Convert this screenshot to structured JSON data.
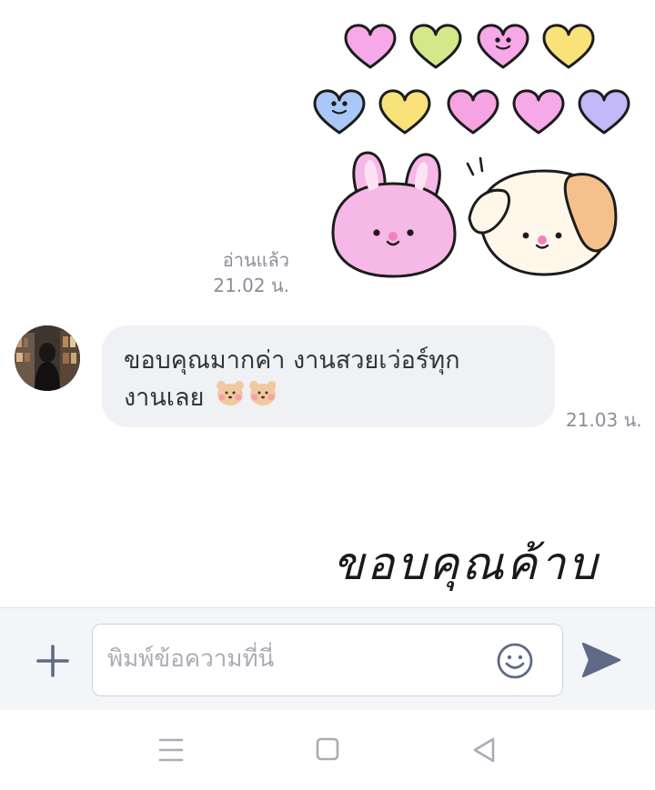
{
  "messages": {
    "sent_sticker": {
      "name": "pastel-hearts-bunny-puppy-sticker",
      "heart_colors": [
        "#f7a8e8",
        "#d4e88a",
        "#f7a8e8",
        "#f9e27a",
        "#a9c8f5",
        "#f9e27a",
        "#f5a3e3",
        "#f7a8e8",
        "#c2b8f7"
      ]
    },
    "read_status": "อ่านแล้ว",
    "sent_time": "21.02 น.",
    "received": {
      "text_line1": "ขอบคุณมากค่า งานสวยเว่อร์ทุก",
      "text_line2": "งานเลย",
      "emoji": "bear-face-emoji",
      "time": "21.03 น."
    },
    "text_sticker": {
      "text": "ขอบคุณค้าบ"
    }
  },
  "input": {
    "placeholder": "พิมพ์ข้อความที่นี่",
    "value": ""
  },
  "icons": {
    "add": "plus-icon",
    "emoji": "smiley-icon",
    "send": "send-arrow-icon",
    "nav_recent": "menu-lines-icon",
    "nav_home": "square-icon",
    "nav_back": "triangle-back-icon"
  },
  "colors": {
    "bubble_bg": "#f0f1f4",
    "meta_text": "#8a8f99",
    "icon_slate": "#5f6b85",
    "input_bar_bg": "#f4f5f8",
    "bunny_pink": "#f6b8e6",
    "puppy_orange": "#f4c08c"
  }
}
